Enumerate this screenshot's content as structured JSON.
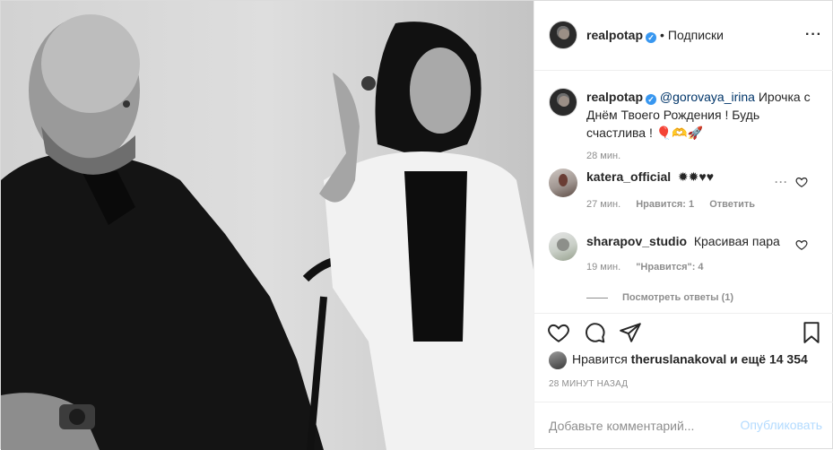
{
  "post": {
    "author": "realpotap",
    "header_state": "Подписки",
    "caption": {
      "mention": "@gorovaya_irina",
      "text": "Ирочка с Днём Твоего Рождения ! Будь счастлива ! 🎈🫶🚀",
      "time": "28 мин."
    }
  },
  "comments": [
    {
      "user": "katera_official",
      "text": "✹✹♥♥",
      "time": "27 мин.",
      "likes": "Нравится: 1",
      "reply": "Ответить"
    },
    {
      "user": "sharapov_studio",
      "text": "Красивая пара",
      "time": "19 мин.",
      "likes": "\"Нравится\": 4",
      "replies": "Посмотреть ответы (1)"
    }
  ],
  "likes": {
    "prefix": "Нравится",
    "user": "theruslanakoval",
    "suffix": "и ещё 14 354"
  },
  "posted_ago": "28 МИНУТ НАЗАД",
  "add_comment": {
    "placeholder": "Добавьте комментарий...",
    "publish": "Опубликовать"
  },
  "icons": {
    "more": "more-horizontal-icon",
    "verified": "verified-badge-icon",
    "like": "heart-icon",
    "comment": "comment-bubble-icon",
    "share": "paper-plane-icon",
    "save": "bookmark-icon"
  },
  "colors": {
    "link": "#003569",
    "verified": "#3897f0",
    "muted": "#8e8e8e",
    "publish_disabled": "#b3dbff"
  }
}
